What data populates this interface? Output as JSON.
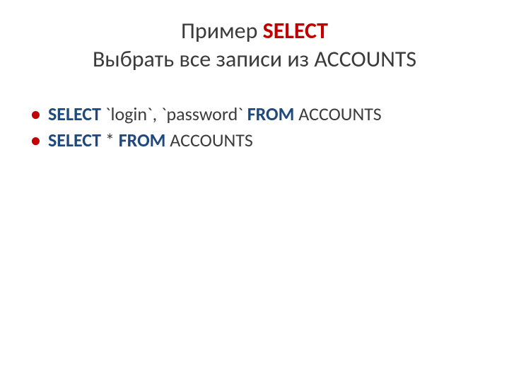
{
  "colors": {
    "red": "#c00000",
    "blue": "#1f497d",
    "text": "#3b3b3b"
  },
  "title": {
    "line1_prefix": "Пример ",
    "line1_keyword": "SELECT",
    "line2": "Выбрать все записи из ACCOUNTS"
  },
  "bullet_glyph": "•",
  "items": [
    {
      "select_kw": "SELECT",
      "cols": " `login`, `password` ",
      "from_kw": "FROM",
      "rest": " ACCOUNTS"
    },
    {
      "select_kw": "SELECT",
      "cols": " * ",
      "from_kw": "FROM",
      "rest": " ACCOUNTS"
    }
  ]
}
